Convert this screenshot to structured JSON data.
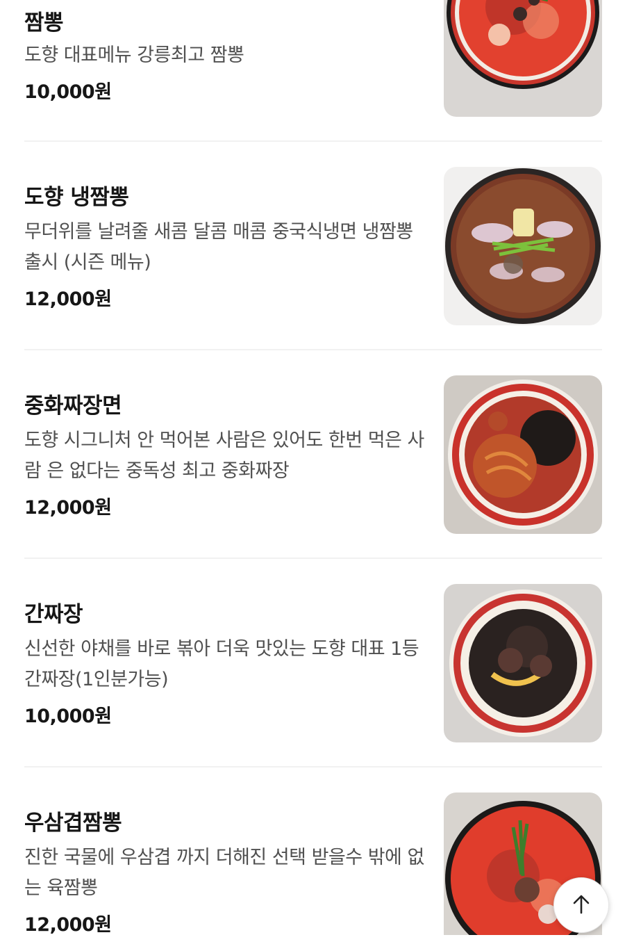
{
  "menu": {
    "items": [
      {
        "name": "짬뽕",
        "description": "도향 대표메뉴 강릉최고 짬뽕",
        "price": "10,000원",
        "image_icon": "jjamppong-photo"
      },
      {
        "name": "도향 냉짬뽕",
        "description": "무더위를 날려줄 새콤 달콤 매콤 중국식냉면 냉짬뽕 출시 (시즌 메뉴)",
        "price": "12,000원",
        "image_icon": "cold-jjamppong-photo"
      },
      {
        "name": "중화짜장면",
        "description": "도향 시그니처 안 먹어본 사람은 있어도 한번 먹은 사람 은 없다는 중독성 최고 중화짜장",
        "price": "12,000원",
        "image_icon": "jajangmyeon-photo"
      },
      {
        "name": "간짜장",
        "description": "신선한 야채를 바로 볶아 더욱 맛있는 도향 대표 1등 간짜장(1인분가능)",
        "price": "10,000원",
        "image_icon": "ganjjajang-photo"
      },
      {
        "name": "우삼겹짬뽕",
        "description": "진한 국물에 우삼겹 까지 더해진 선택 받을수 밖에 없는 육짬뽕",
        "price": "12,000원",
        "image_icon": "beef-brisket-jjamppong-photo"
      }
    ]
  },
  "scroll_top": {
    "icon": "arrow-up-icon"
  },
  "colors": {
    "text_primary": "#161616",
    "text_secondary": "#505050",
    "divider": "#f1f1f1",
    "background": "#ffffff"
  }
}
